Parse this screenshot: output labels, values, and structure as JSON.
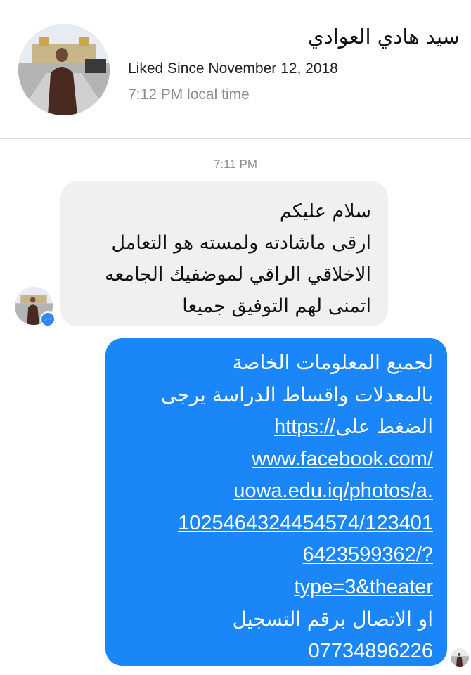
{
  "header": {
    "contact_name": "سيد هادي العوادي",
    "liked_since": "Liked Since November 12, 2018",
    "local_time": "7:12 PM local time"
  },
  "conversation": {
    "timestamp": "7:11 PM",
    "incoming_message": {
      "lines": [
        "سلام عليكم",
        "ارقى ماشادته ولمسته هو التعامل",
        "الاخلاقي الراقي لموضفيك الجامعه",
        "اتمنى لهم التوفيق جميعا"
      ]
    },
    "outgoing_message": {
      "line1": "لجميع المعلومات الخاصة",
      "line2": "بالمعدلات واقساط الدراسة يرجى",
      "line3_text": "الضغط على",
      "line3_link": "https://",
      "link_lines": [
        "www.facebook.com/",
        "uowa.edu.iq/photos/a.",
        "1025464324454574/123401",
        "6423599362/?",
        "type=3&theater"
      ],
      "line_call": "او الاتصال برقم التسجيل",
      "phone": "07734896226"
    }
  },
  "icons": {
    "contact_avatar": "contact-avatar-photo",
    "messenger_badge": "messenger-icon",
    "read_receipt": "read-receipt-avatar"
  },
  "colors": {
    "outgoing_bubble": "#1a86f7",
    "incoming_bubble": "#f0f0f0",
    "messenger_badge": "#2d88ff",
    "muted_text": "#8a8d91"
  }
}
